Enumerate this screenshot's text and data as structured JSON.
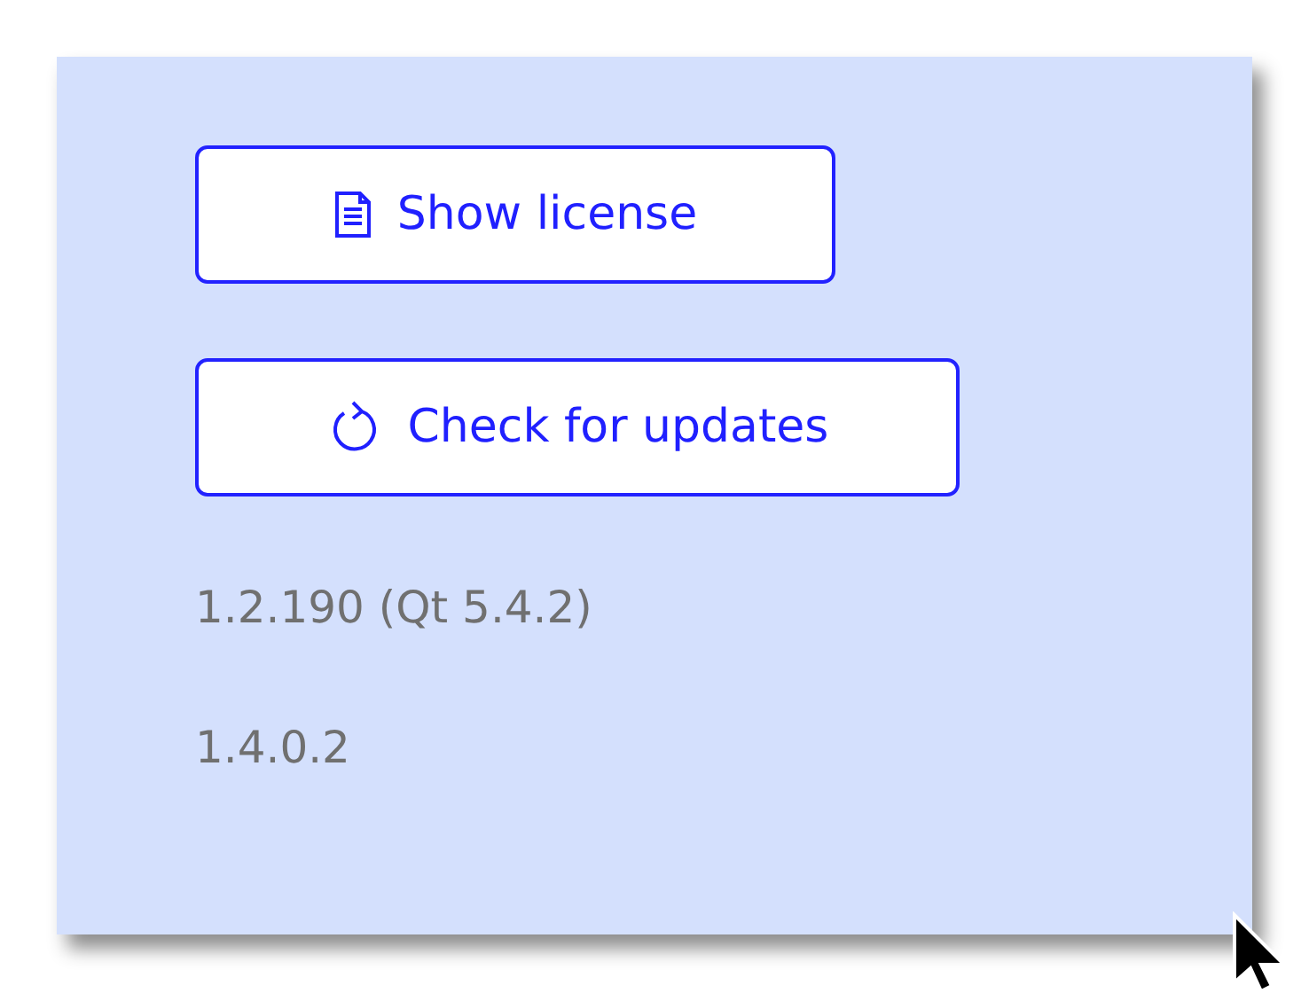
{
  "buttons": [
    {
      "label": "Show license"
    },
    {
      "label": "Check for updates"
    }
  ],
  "versions": [
    "1.2.190 (Qt 5.4.2)",
    "1.4.0.2"
  ]
}
